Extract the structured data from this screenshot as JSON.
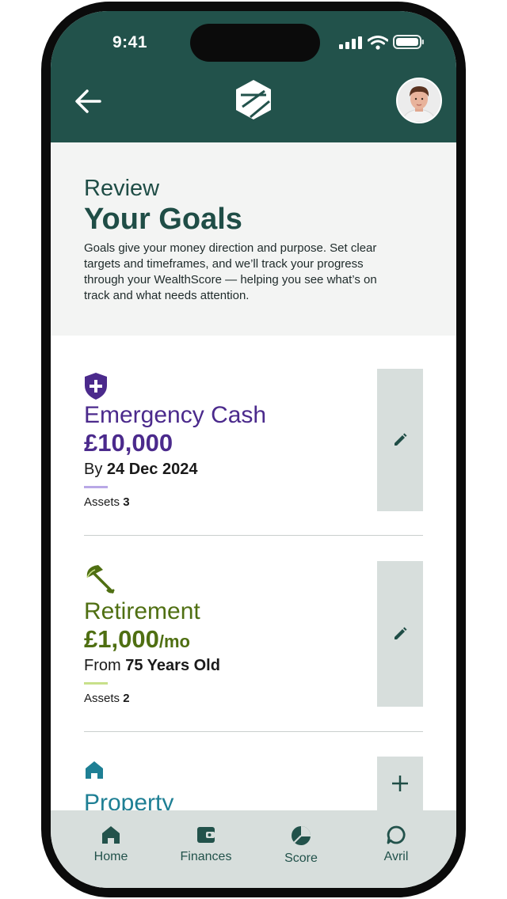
{
  "status_bar": {
    "time": "9:41"
  },
  "header": {
    "back_icon": "arrow-left-icon",
    "logo_icon": "hexagon-logo-icon",
    "avatar_icon": "user-avatar"
  },
  "intro": {
    "eyebrow": "Review",
    "title": "Your Goals",
    "description": "Goals give your money direction and purpose. Set clear targets and timeframes, and we’ll track your progress through your WealthScore — helping you see what’s on track and what needs attention."
  },
  "goals": [
    {
      "icon": "shield-plus-icon",
      "name": "Emergency Cash",
      "amount": "£10,000",
      "amount_unit": "",
      "date_prefix": "By",
      "date_value": "24 Dec 2024",
      "assets_label": "Assets",
      "assets_count": "3",
      "color": "#4b2a8c",
      "rule_color": "#b9a8e6",
      "action_icon": "pencil-icon"
    },
    {
      "icon": "umbrella-icon",
      "name": "Retirement",
      "amount": "£1,000",
      "amount_unit": "/mo",
      "date_prefix": "From",
      "date_value": "75 Years Old",
      "assets_label": "Assets",
      "assets_count": "2",
      "color": "#4f6f12",
      "rule_color": "#c8e08a",
      "action_icon": "pencil-icon"
    },
    {
      "icon": "house-icon",
      "name": "Property",
      "color": "#1e7f94",
      "action_icon": "plus-icon"
    }
  ],
  "tabbar": {
    "items": [
      {
        "label": "Home",
        "icon": "home-icon"
      },
      {
        "label": "Finances",
        "icon": "wallet-icon"
      },
      {
        "label": "Score",
        "icon": "score-pie-icon"
      },
      {
        "label": "Avril",
        "icon": "chat-bubble-icon"
      }
    ]
  },
  "colors": {
    "header_bg": "#22524b",
    "intro_bg": "#f3f4f3",
    "tabbar_bg": "#d7dedc",
    "accent_green": "#22524b"
  }
}
